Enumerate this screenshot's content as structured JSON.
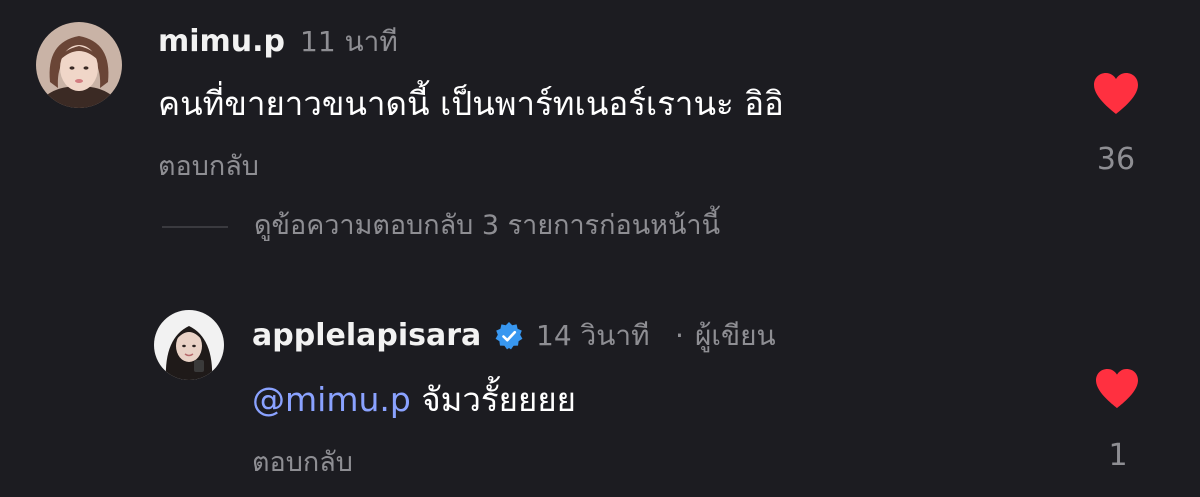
{
  "comment1": {
    "username": "mimu.p",
    "time": "11 นาที",
    "text": "คนที่ขายาวขนาดนี้ เป็นพาร์ทเนอร์เรานะ อิอิ",
    "reply_label": "ตอบกลับ",
    "like_count": "36",
    "liked": true
  },
  "view_replies": {
    "label": "ดูข้อความตอบกลับ 3 รายการก่อนหน้านี้"
  },
  "comment2": {
    "username": "applelapisara",
    "verified": true,
    "time": "14 วินาที",
    "separator": "·",
    "author_tag": "ผู้เขียน",
    "mention": "@mimu.p",
    "text": "จัมวรั้ยยยย",
    "reply_label": "ตอบกลับ",
    "like_count": "1",
    "liked": true
  },
  "colors": {
    "background": "#1c1c21",
    "heart": "#ff3040",
    "mention": "#8aa2ff",
    "secondary_text": "#8e8e93",
    "verified_badge": "#3897f0"
  },
  "icons": {
    "like": "heart-icon",
    "verified": "verified-badge-icon"
  }
}
